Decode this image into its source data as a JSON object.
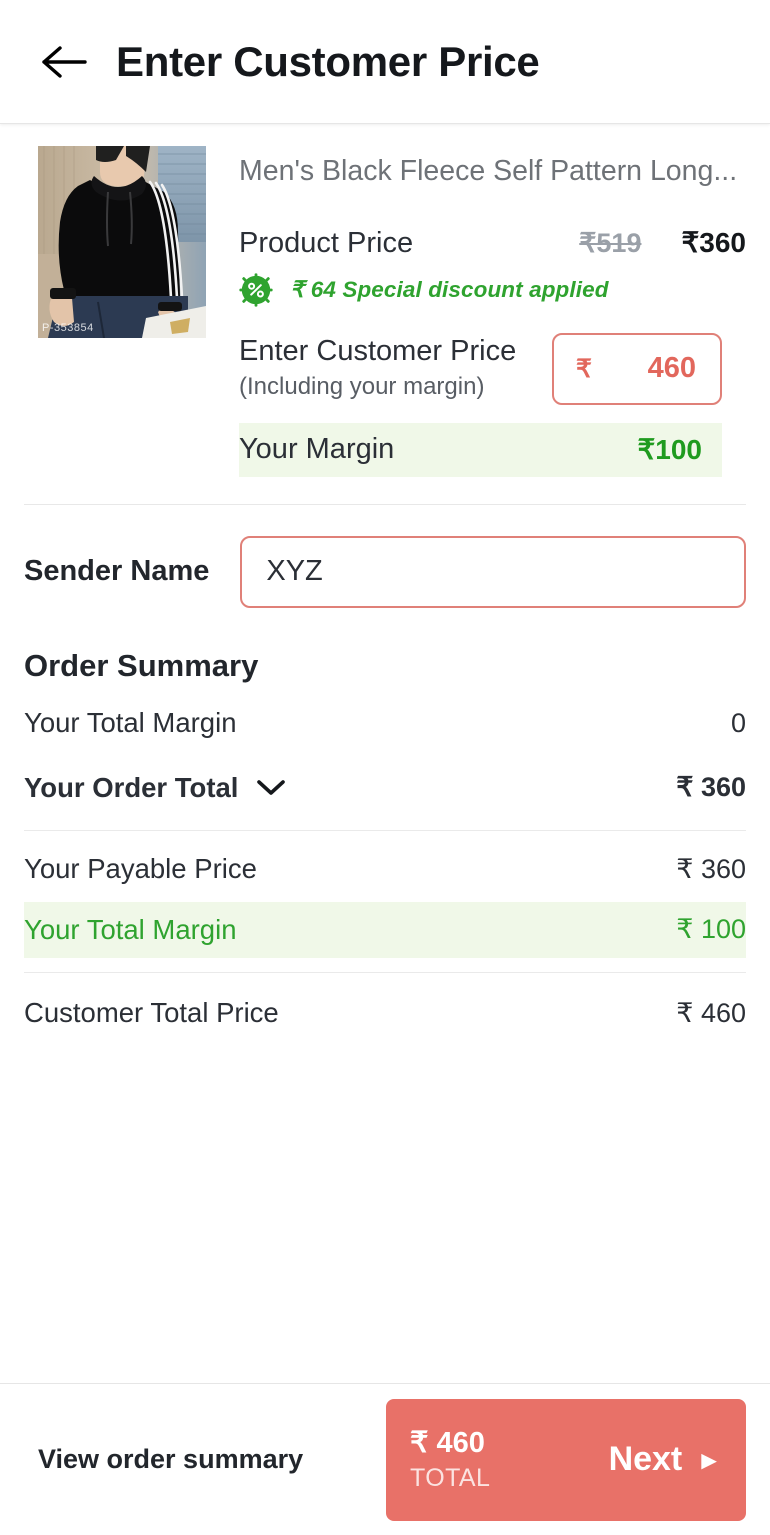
{
  "header": {
    "back_icon": "arrow-left-icon",
    "title": "Enter Customer Price"
  },
  "product": {
    "image_alt": "mens-black-fleece-hoodie",
    "image_watermark": "P-353854",
    "title": "Men's Black Fleece Self Pattern Long...",
    "price_label": "Product Price",
    "price_original": "₹519",
    "price_current": "₹360",
    "discount_icon": "percent-badge-icon",
    "discount_text": "₹ 64 Special discount applied"
  },
  "customer_price": {
    "label": "Enter Customer Price",
    "sublabel": "(Including your margin)",
    "currency_symbol": "₹",
    "value": "460",
    "placeholder": "0"
  },
  "margin_strip": {
    "label": "Your Margin",
    "value": "₹100"
  },
  "sender": {
    "label": "Sender Name",
    "value": "XYZ",
    "placeholder": "Enter sender name"
  },
  "order_summary": {
    "title": "Order Summary",
    "rows": [
      {
        "label": "Your Total Margin",
        "value": "0"
      },
      {
        "label": "Your Order Total",
        "value": "₹ 360",
        "chevron_icon": "chevron-down-icon"
      },
      {
        "label": "Your Payable Price",
        "value": "₹ 360"
      },
      {
        "label": "Your Total Margin",
        "value": "₹ 100"
      },
      {
        "label": "Customer Total Price",
        "value": "₹ 460"
      }
    ]
  },
  "bottom_bar": {
    "view_summary_label": "View order summary",
    "total_amount": "₹ 460",
    "total_caption": "TOTAL",
    "next_label": "Next",
    "next_arrow_icon": "play-triangle-icon"
  },
  "colors": {
    "accent_coral": "#e87168",
    "input_border": "#e08078",
    "green": "#2fa32f",
    "green_bg": "#f0f8e8",
    "text_dark": "#22262c",
    "text_muted": "#6e7277"
  }
}
